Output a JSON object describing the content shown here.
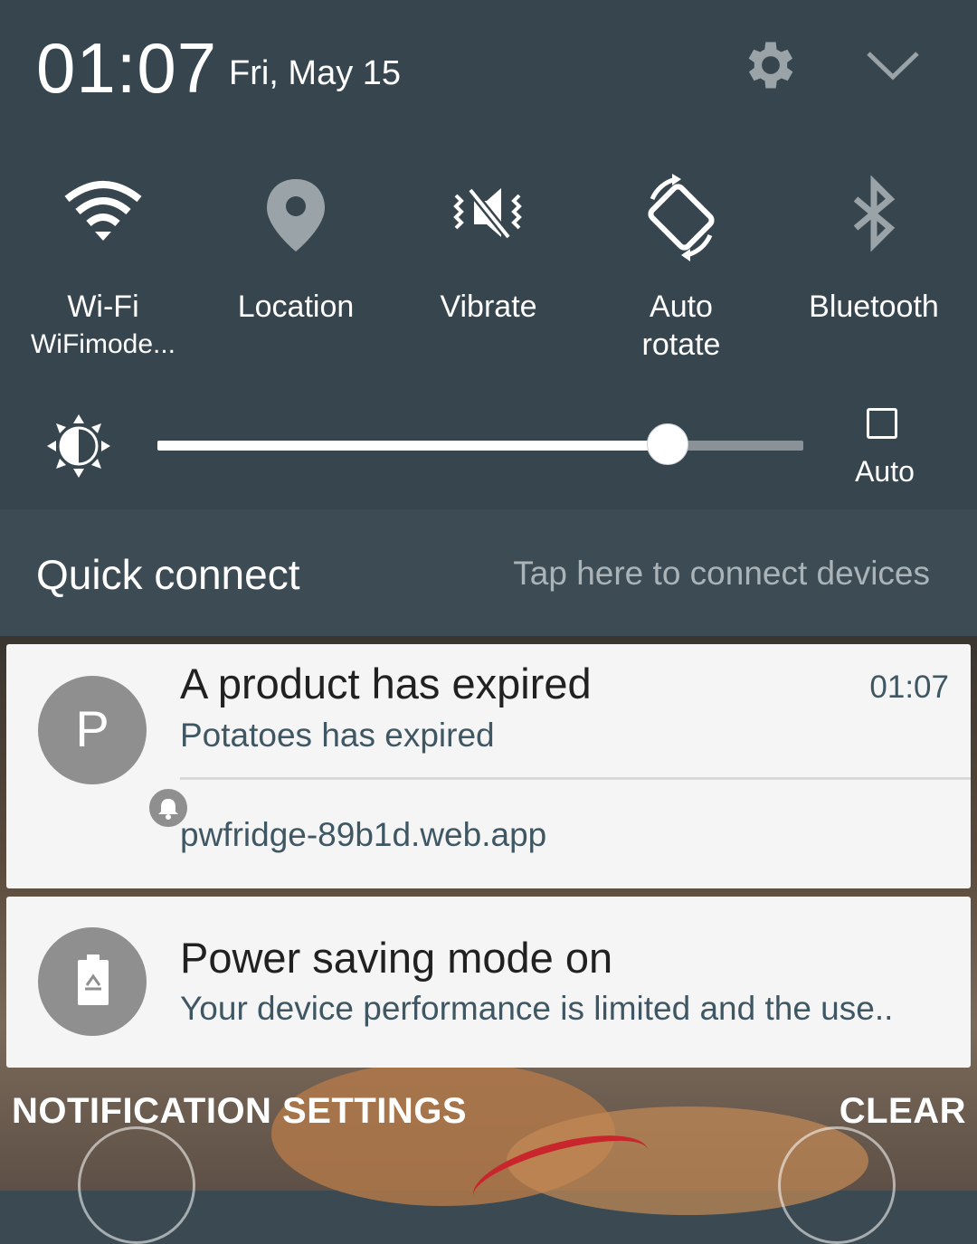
{
  "status": {
    "time": "01:07",
    "date": "Fri, May 15"
  },
  "header_icons": [
    "gear-icon",
    "chevron-down-icon"
  ],
  "quick_settings": {
    "tiles": [
      {
        "label": "Wi-Fi",
        "sublabel": "WiFimode...",
        "icon": "wifi-icon"
      },
      {
        "label": "Location",
        "icon": "location-pin-icon"
      },
      {
        "label": "Vibrate",
        "icon": "vibrate-icon"
      },
      {
        "label": "Auto rotate",
        "icon": "auto-rotate-icon"
      },
      {
        "label": "Bluetooth",
        "icon": "bluetooth-icon"
      }
    ],
    "brightness": {
      "level_fraction": 0.79,
      "auto_label": "Auto",
      "auto_checked": false
    }
  },
  "quick_connect": {
    "title": "Quick connect",
    "hint": "Tap here to connect devices"
  },
  "notifications": [
    {
      "avatar_letter": "P",
      "title": "A product has expired",
      "body": "Potatoes has expired",
      "time": "01:07",
      "app": "pwfridge-89b1d.web.app"
    },
    {
      "icon": "battery-recycle-icon",
      "title": "Power saving mode on",
      "body": "Your device performance is limited and the use.."
    }
  ],
  "actions": {
    "settings_label": "NOTIFICATION SETTINGS",
    "clear_label": "CLEAR"
  },
  "colors": {
    "panel_bg": "#37464e",
    "card_bg": "#f5f5f5",
    "secondary_text": "#3f5763",
    "avatar_bg": "#8f8f8f"
  }
}
